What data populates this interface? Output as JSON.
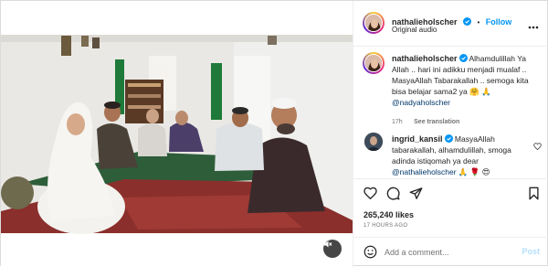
{
  "header": {
    "username": "nathalieholscher",
    "separator": "•",
    "follow_label": "Follow",
    "subtitle": "Original audio",
    "more_icon": "more-horizontal-icon"
  },
  "caption": {
    "username": "nathalieholscher",
    "text": "Alhamdulillah Ya Allah .. hari ini adikku menjadi mualaf .. MasyaAllah Tabarakallah .. semoga kita bisa belajar sama2 ya",
    "emojis": "🤗 🙏",
    "mention": "@nadyaholscher",
    "time": "17h",
    "translation_label": "See translation"
  },
  "comment": {
    "username": "ingrid_kansil",
    "text": "MasyaAllah tabarakallah, alhamdulillah, smoga adinda istiqomah ya dear",
    "mention": "@nathalieholscher",
    "emojis": "🙏 🌹 😍"
  },
  "actions": {
    "likes": "265,240 likes",
    "timeago": "17 HOURS AGO"
  },
  "add_comment": {
    "placeholder": "Add a comment...",
    "post_label": "Post"
  },
  "colors": {
    "accent": "#0095f6",
    "verified": "#0095f6",
    "post_disabled": "#b2dffc"
  }
}
